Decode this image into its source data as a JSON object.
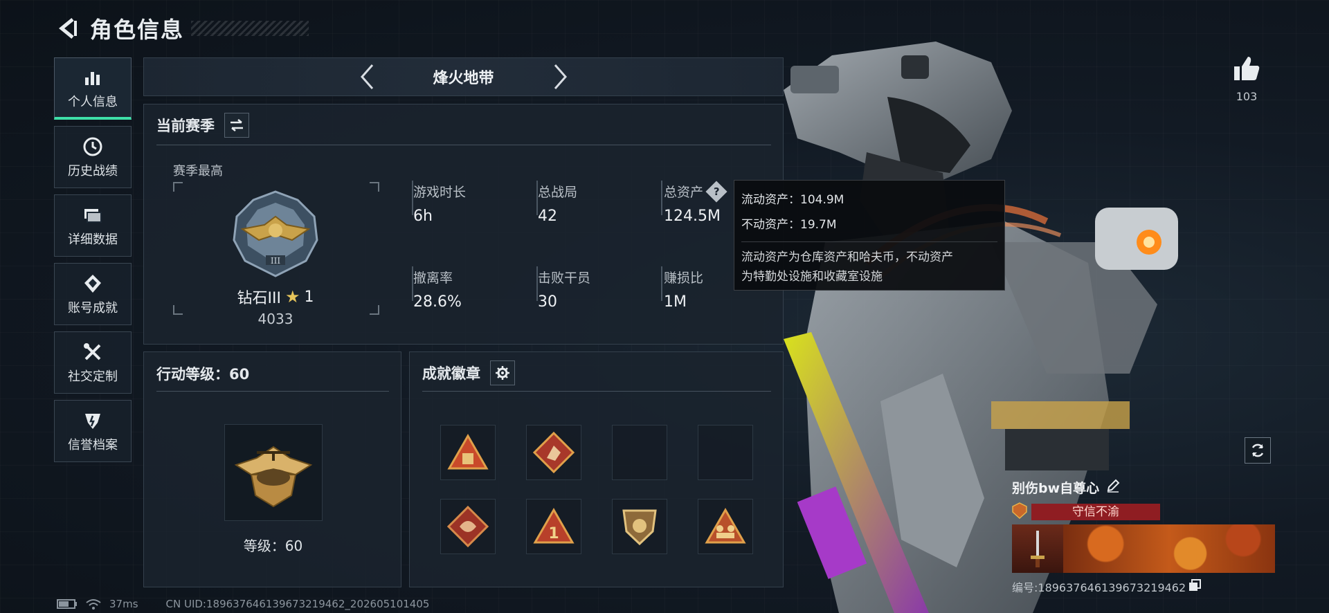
{
  "header": {
    "title": "角色信息"
  },
  "sidebar": {
    "items": [
      {
        "label": "个人信息",
        "icon": "bar-chart-icon",
        "active": true
      },
      {
        "label": "历史战绩",
        "icon": "clock-icon"
      },
      {
        "label": "详细数据",
        "icon": "folder-icon"
      },
      {
        "label": "账号成就",
        "icon": "medal-icon"
      },
      {
        "label": "社交定制",
        "icon": "tools-icon"
      },
      {
        "label": "信誉档案",
        "icon": "shield-icon"
      }
    ]
  },
  "mode": {
    "current": "烽火地带"
  },
  "season": {
    "title": "当前赛季",
    "best_label": "赛季最高",
    "rank_name": "钻石III",
    "rank_stars": "1",
    "rank_points": "4033",
    "stats": [
      {
        "label": "游戏时长",
        "value": "6h"
      },
      {
        "label": "总战局",
        "value": "42"
      },
      {
        "label": "总资产",
        "value": "124.5M"
      },
      {
        "label": "撤离率",
        "value": "28.6%"
      },
      {
        "label": "击败干员",
        "value": "30"
      },
      {
        "label": "赚损比",
        "value": "1M"
      }
    ]
  },
  "tooltip": {
    "liquid": "流动资产：104.9M",
    "fixed": "不动资产：19.7M",
    "desc1": "流动资产为仓库资产和哈夫币，不动资产",
    "desc2": "为特勤处设施和收藏室设施"
  },
  "action_level": {
    "title": "行动等级：60",
    "level_text": "等级：60"
  },
  "achievements": {
    "title": "成就徽章"
  },
  "likes": {
    "count": "103"
  },
  "player": {
    "name": "别伤bw自尊心",
    "title_badge": "守信不渝",
    "id_text": "编号:189637646139673219462"
  },
  "status_bar": {
    "ping": "37ms",
    "uid": "CN UID:189637646139673219462_202605101405"
  },
  "colors": {
    "accent": "#3ee0a8",
    "title_red": "#8f1d22",
    "gold": "#c9a24a"
  }
}
